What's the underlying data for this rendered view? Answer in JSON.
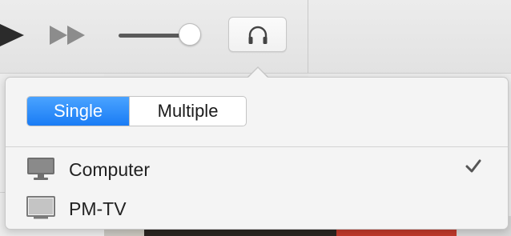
{
  "toolbar": {
    "controls": [
      "play-icon",
      "fast-forward-icon",
      "volume-slider",
      "headphones-icon"
    ],
    "volume_level": 0.8
  },
  "popover": {
    "mode_options": [
      "Single",
      "Multiple"
    ],
    "selected_mode": "Single",
    "devices": [
      {
        "label": "Computer",
        "icon": "computer-monitor-icon",
        "checked": true
      },
      {
        "label": "PM-TV",
        "icon": "tv-monitor-icon",
        "checked": false
      }
    ]
  },
  "colors": {
    "accent": "#1a7cf5",
    "icon_gray": "#6f6f6f"
  }
}
